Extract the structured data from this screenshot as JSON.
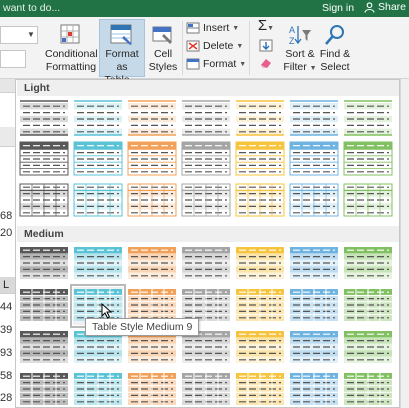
{
  "titlebar": {
    "tell_me": "want to do...",
    "sign_in": "Sign in",
    "share": "Share",
    "background": "#217346"
  },
  "ribbon": {
    "conditional_formatting": [
      "Conditional",
      "Formatting"
    ],
    "format_as_table": [
      "Format as",
      "Table"
    ],
    "cell_styles": [
      "Cell",
      "Styles"
    ],
    "insert": "Insert",
    "delete": "Delete",
    "format": "Format",
    "sort_filter": [
      "Sort &",
      "Filter"
    ],
    "find_select": [
      "Find &",
      "Select"
    ]
  },
  "sheet": {
    "column_header": "L",
    "row_numbers": [
      "68",
      "20",
      "44",
      "39",
      "93",
      "58",
      "28"
    ]
  },
  "gallery": {
    "sections": [
      "Light",
      "Medium"
    ],
    "tooltip": "Table Style Medium 9",
    "hover_style": "Table Style Medium 9",
    "palette": {
      "black": "#595959",
      "blue": "#5bc3d6",
      "orange": "#f2a15a",
      "gray": "#a5a5a5",
      "gold": "#f7c43f",
      "lightblue": "#6fb4e0",
      "green": "#82c161"
    }
  }
}
